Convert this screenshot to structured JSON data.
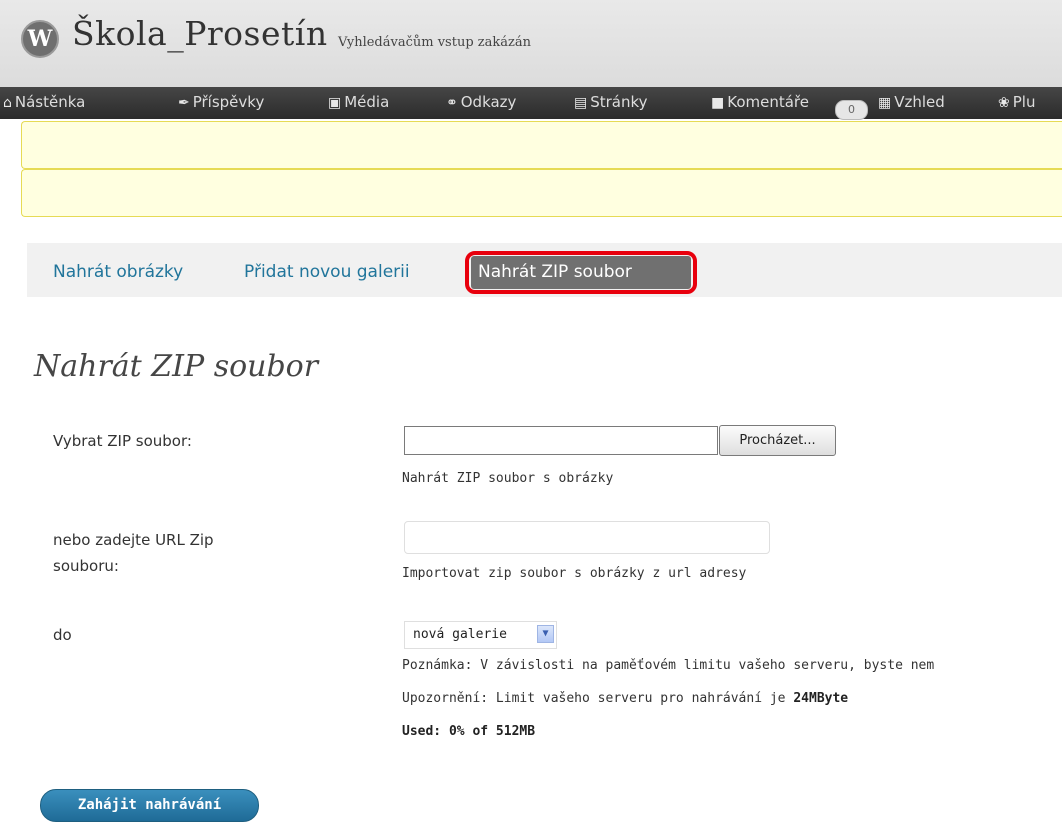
{
  "header": {
    "logo_letter": "W",
    "site_title": "Škola_Prosetín",
    "site_note": "Vyhledávačům vstup zakázán"
  },
  "menu": {
    "items": [
      {
        "label": "Nástěnka",
        "icon": "home-icon"
      },
      {
        "label": "Příspěvky",
        "icon": "pin-icon"
      },
      {
        "label": "Média",
        "icon": "media-icon"
      },
      {
        "label": "Odkazy",
        "icon": "link-icon"
      },
      {
        "label": "Stránky",
        "icon": "pages-icon"
      },
      {
        "label": "Komentáře",
        "icon": "comment-icon"
      },
      {
        "label": "Vzhled",
        "icon": "appearance-icon"
      },
      {
        "label": "Plu",
        "icon": "plugin-icon"
      }
    ],
    "comment_count": "0"
  },
  "tabs": {
    "upload_images": "Nahrát obrázky",
    "add_gallery": "Přidat novou galerii",
    "upload_zip": "Nahrát ZIP soubor"
  },
  "page": {
    "title": "Nahrát ZIP soubor"
  },
  "form": {
    "zip_label": "Vybrat ZIP soubor:",
    "zip_value": "",
    "browse_label": "Procházet...",
    "zip_hint": "Nahrát ZIP soubor s obrázky",
    "url_label_1": "nebo zadejte URL Zip",
    "url_label_2": "souboru:",
    "url_value": "",
    "url_hint": "Importovat zip soubor s obrázky z url adresy",
    "target_label": "do",
    "target_selected": "nová galerie",
    "note": "Poznámka: V závislosti na paměťovém limitu vašeho serveru, byste nem",
    "warning_prefix": "Upozornění: Limit vašeho serveru pro nahrávání je ",
    "warning_limit": "24MByte",
    "used": "Used: 0% of 512MB",
    "submit_label": "Zahájit nahrávání"
  },
  "colors": {
    "menubar": "#2b2b2b",
    "notice_bg": "#ffffe0",
    "link": "#21759b",
    "highlight_border": "#e8000d",
    "button": "#1f6b97"
  }
}
